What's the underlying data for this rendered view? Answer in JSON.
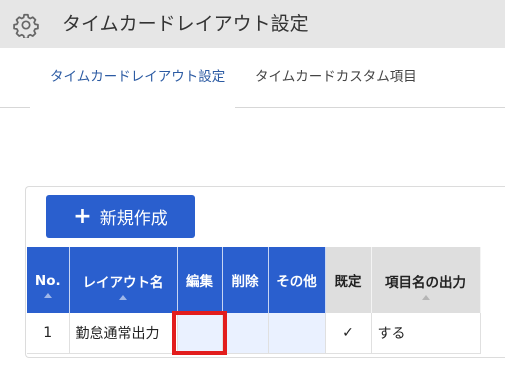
{
  "header": {
    "icon": "gear-icon",
    "title": "タイムカードレイアウト設定"
  },
  "tabs": [
    {
      "label": "タイムカードレイアウト設定",
      "active": true
    },
    {
      "label": "タイムカードカスタム項目",
      "active": false
    }
  ],
  "toolbar": {
    "new_button_label": "新規作成",
    "new_button_icon": "plus-icon"
  },
  "table": {
    "columns": [
      "No.",
      "レイアウト名",
      "編集",
      "削除",
      "その他",
      "既定",
      "項目名の出力"
    ],
    "rows": [
      {
        "no": "1",
        "name": "勤怠通常出力",
        "edit": "",
        "delete": "",
        "other": "",
        "default": "✓",
        "output": "する"
      }
    ]
  },
  "colors": {
    "header_bg": "#e6e6e6",
    "accent": "#2a5fce",
    "active_tab": "#2c5ba3",
    "highlight": "#e21d1d"
  }
}
